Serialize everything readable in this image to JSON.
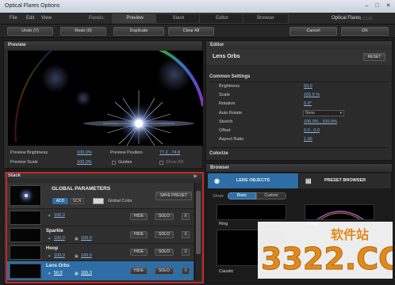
{
  "window": {
    "title": "Optical Flares Options",
    "version": "1.3.150"
  },
  "menu": {
    "file": "File",
    "edit": "Edit",
    "view": "View"
  },
  "panels": {
    "label": "Panels:",
    "tabs": [
      "Preview",
      "Stack",
      "Editor",
      "Browser"
    ],
    "active": "Preview"
  },
  "brand": "Optical Flares",
  "toolbar": {
    "undo": "Undo (7)",
    "redo": "Redo (0)",
    "duplicate": "Duplicate",
    "clear_all": "Clear All",
    "cancel": "Cancel",
    "ok": "OK"
  },
  "preview": {
    "title": "Preview",
    "brightness_label": "Preview Brightness",
    "brightness_value": "100.0%",
    "scale_label": "Preview Scale",
    "scale_value": "100.0%",
    "position_label": "Preview Position",
    "position_value": "77.2 , 74.8",
    "guides_label": "Guides",
    "showbb_label": "Show BB"
  },
  "stack": {
    "title": "Stack",
    "global": {
      "title": "GLOBAL PARAMETERS",
      "add": "ADD",
      "scn": "SCN",
      "global_color": "Global Color",
      "save_preset": "SAVE PRESET"
    },
    "rows": [
      {
        "name": "",
        "brightness": "100.0",
        "scale": "",
        "selected": false
      },
      {
        "name": "Sparkle",
        "brightness": "100.0",
        "scale": "100.0",
        "selected": false
      },
      {
        "name": "Hoop",
        "brightness": "100.0",
        "scale": "100.0",
        "selected": false
      },
      {
        "name": "Lens Orbs",
        "brightness": "50.0",
        "scale": "165.3",
        "selected": true
      }
    ],
    "hide": "HIDE",
    "solo": "SOLO",
    "x": "X"
  },
  "editor": {
    "title": "Editor",
    "lens_name": "Lens Orbs",
    "reset": "RESET",
    "common_title": "Common Settings",
    "fields": [
      {
        "label": "Brightness",
        "value": "50.0"
      },
      {
        "label": "Scale",
        "value": "165.5 %"
      },
      {
        "label": "Rotation",
        "value": "0.0°"
      },
      {
        "label": "Auto Rotate",
        "value": "None"
      },
      {
        "label": "Stretch",
        "value": "100.0% , 100.0%"
      },
      {
        "label": "Offset",
        "value": "0.0 , 0.0"
      },
      {
        "label": "Aspect Ratio",
        "value": "1.00"
      }
    ],
    "colorize_title": "Colorize"
  },
  "browser": {
    "title": "Browser",
    "lens_objects": "LENS OBJECTS",
    "preset_browser": "PRESET BROWSER",
    "show_label": "Show",
    "basic": "Basic",
    "custom": "Custom",
    "items": [
      "Ring",
      "Hoop",
      "Caustic"
    ]
  },
  "watermark": {
    "text": "3322.CC",
    "sub": "软件站"
  },
  "colors": {
    "accent": "#2e6ea6",
    "highlight": "#c62828",
    "link": "#8ab4e8",
    "watermark": "#e08a1a"
  }
}
